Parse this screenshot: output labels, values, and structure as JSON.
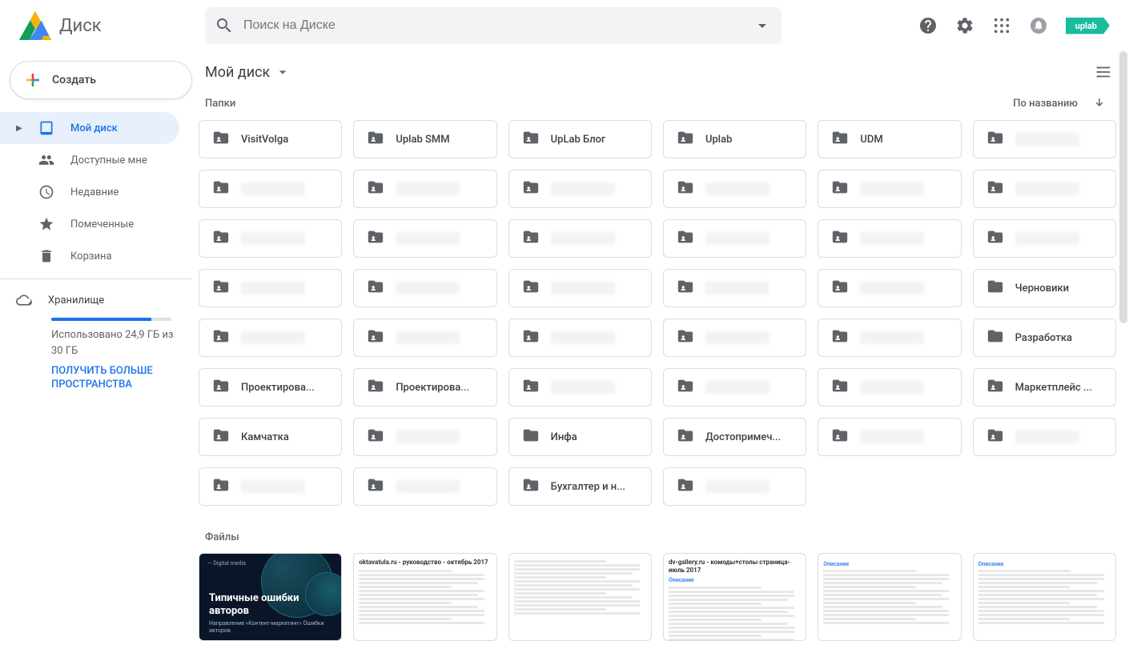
{
  "app": {
    "title": "Диск"
  },
  "search": {
    "placeholder": "Поиск на Диске"
  },
  "header": {
    "uplab_tag": "uplab"
  },
  "create_button": "Создать",
  "sidebar": {
    "items": [
      {
        "label": "Мой диск",
        "icon": "drive"
      },
      {
        "label": "Доступные мне",
        "icon": "people"
      },
      {
        "label": "Недавние",
        "icon": "clock"
      },
      {
        "label": "Помеченные",
        "icon": "star"
      },
      {
        "label": "Корзина",
        "icon": "trash"
      }
    ],
    "storage": {
      "label": "Хранилище",
      "used_text": "Использовано 24,9 ГБ из 30 ГБ",
      "upgrade_link": "ПОЛУЧИТЬ БОЛЬШЕ ПРОСТРАНСТВА"
    }
  },
  "breadcrumb": "Мой диск",
  "section": {
    "folders_label": "Папки",
    "files_label": "Файлы",
    "sort_label": "По названию"
  },
  "folders": [
    {
      "name": "VisitVolga",
      "shared": true
    },
    {
      "name": "Uplab SMM",
      "shared": true
    },
    {
      "name": "UpLab Блог",
      "shared": true
    },
    {
      "name": "Uplab",
      "shared": true
    },
    {
      "name": "UDM",
      "shared": true
    },
    {
      "redacted": true,
      "shared": true
    },
    {
      "redacted": true,
      "shared": true
    },
    {
      "redacted": true,
      "shared": true
    },
    {
      "redacted": true,
      "shared": true
    },
    {
      "redacted": true,
      "shared": true
    },
    {
      "redacted": true,
      "shared": true
    },
    {
      "redacted": true,
      "shared": true
    },
    {
      "redacted": true,
      "shared": true
    },
    {
      "redacted": true,
      "shared": true
    },
    {
      "redacted": true,
      "shared": true
    },
    {
      "redacted": true,
      "shared": true
    },
    {
      "redacted": true,
      "shared": true
    },
    {
      "redacted": true,
      "shared": true
    },
    {
      "redacted": true,
      "shared": true
    },
    {
      "redacted": true,
      "shared": true
    },
    {
      "redacted": true,
      "shared": true
    },
    {
      "redacted": true,
      "shared": true
    },
    {
      "redacted": true,
      "shared": true
    },
    {
      "name": "Черновики",
      "shared": false
    },
    {
      "redacted": true,
      "shared": true
    },
    {
      "redacted": true,
      "shared": true
    },
    {
      "redacted": true,
      "shared": true
    },
    {
      "redacted": true,
      "shared": true
    },
    {
      "redacted": true,
      "shared": true
    },
    {
      "name": "Разработка",
      "shared": false
    },
    {
      "name": "Проектирова...",
      "shared": true
    },
    {
      "name": "Проектирова...",
      "shared": true
    },
    {
      "redacted": true,
      "shared": true
    },
    {
      "redacted": true,
      "shared": true
    },
    {
      "redacted": true,
      "shared": true
    },
    {
      "name": "Маркетплейс ...",
      "shared": true
    },
    {
      "name": "Камчатка",
      "shared": true
    },
    {
      "redacted": true,
      "shared": true
    },
    {
      "name": "Инфа",
      "shared": false
    },
    {
      "name": "Достопримеч...",
      "shared": true
    },
    {
      "redacted": true,
      "shared": true
    },
    {
      "redacted": true,
      "shared": true
    },
    {
      "redacted": true,
      "shared": true
    },
    {
      "redacted": true,
      "shared": true
    },
    {
      "name": "Бухгалтер и н...",
      "shared": true
    },
    {
      "redacted": true,
      "shared": true
    }
  ],
  "files": [
    {
      "type": "dark",
      "tag": "— Digital media",
      "title": "Типичные ошибки авторов",
      "sub": "Направление «Контент-маркетинг» Ошибки авторов"
    },
    {
      "type": "doc",
      "title": "oktavatula.ru - руководство - октябрь 2017"
    },
    {
      "type": "doc",
      "title": ""
    },
    {
      "type": "doc",
      "title": "dv-gallery.ru - комоды+столы страница- июль 2017",
      "blue": true
    },
    {
      "type": "doc",
      "title": "",
      "blue": true
    },
    {
      "type": "doc",
      "title": "",
      "blue": true
    }
  ]
}
